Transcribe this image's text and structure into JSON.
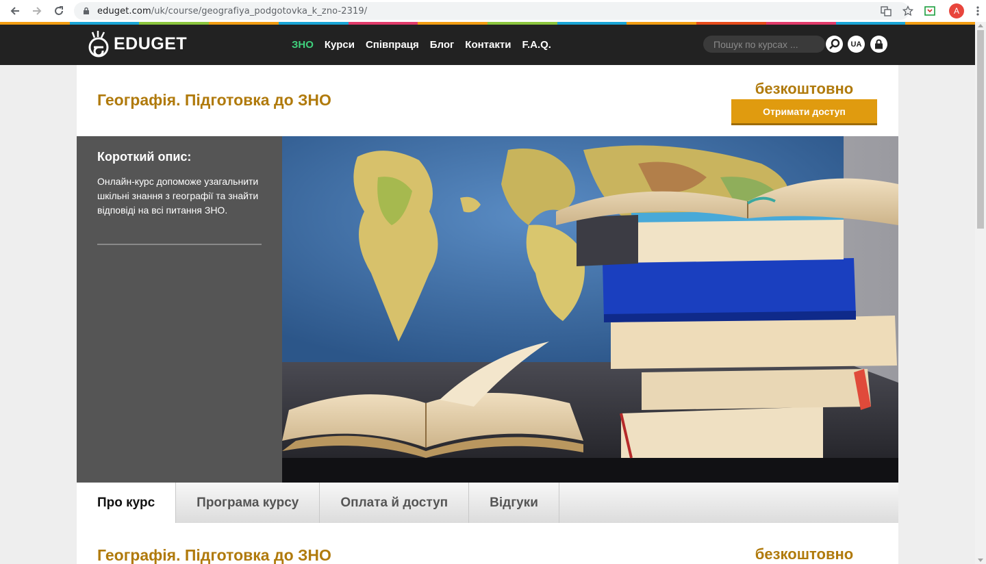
{
  "browser": {
    "url_host": "eduget.com",
    "url_path": "/uk/course/geografiya_podgotovka_k_zno-2319/",
    "profile_initial": "A"
  },
  "colors": {
    "accent_gold": "#b07a0c",
    "button_orange": "#e09b0f",
    "nav_active_green": "#3fd07c",
    "header_bg": "#222222",
    "panel_gray": "#555555",
    "stripe": [
      "#f29d13",
      "#1aa5d6",
      "#8cc63e",
      "#f29d13",
      "#1aa5d6",
      "#e23b6b",
      "#f29d13",
      "#8cc63e",
      "#1aa5d6",
      "#f29d13",
      "#e74c1c",
      "#e23b6b",
      "#1aa5d6",
      "#f29d13"
    ]
  },
  "site": {
    "logo_text": "EDUGET",
    "nav": [
      {
        "label": "ЗНО",
        "active": true
      },
      {
        "label": "Курси"
      },
      {
        "label": "Співпраця"
      },
      {
        "label": "Блог"
      },
      {
        "label": "Контакти"
      },
      {
        "label": "F.A.Q."
      }
    ],
    "search_placeholder": "Пошук по курсах ...",
    "lang": "UA"
  },
  "course": {
    "title": "Географія. Підготовка до ЗНО",
    "price": "безкоштовно",
    "access_button": "Отримати доступ",
    "desc_heading": "Короткий опис:",
    "desc_text": "Онлайн-курс допоможе узагальнити шкільні знання з географії та знайти відповіді на всі питання ЗНО."
  },
  "tabs": [
    {
      "label": "Про курс",
      "active": true
    },
    {
      "label": "Програма курсу"
    },
    {
      "label": "Оплата й доступ"
    },
    {
      "label": "Відгуки"
    }
  ],
  "section2": {
    "title": "Географія. Підготовка до ЗНО",
    "price": "безкоштовно"
  }
}
